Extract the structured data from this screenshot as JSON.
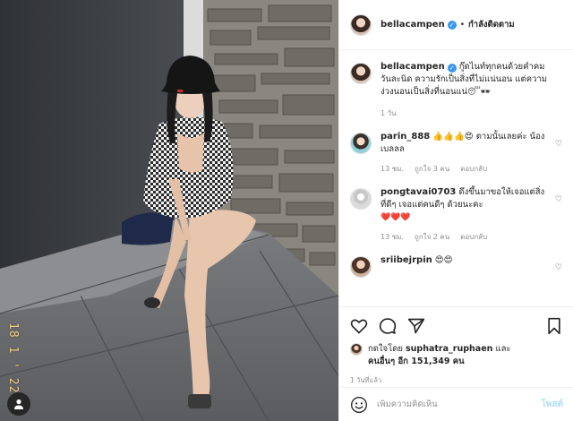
{
  "photo": {
    "date_stamp": "18 1 ' 22",
    "tag_icon": "user-tag-icon"
  },
  "header": {
    "username": "bellacampen",
    "separator": "•",
    "follow_label": "กำลังติดตาม",
    "more_label": "…"
  },
  "caption": {
    "username": "bellacampen",
    "text": "กู๊ดไนท์ทุกคนด้วยคำคม วันละนิด ความรักเป็นสิ่งที่ไม่แน่นอน แต่ความง่วงนอนเป็นสิ่งที่นอนแน่",
    "emoji": "😴🕶",
    "time": "1 วัน"
  },
  "comments": [
    {
      "username": "parin_888",
      "text": "👍👍👍😍 ตามนั้นเลยค่ะ น้องเบลลล",
      "time": "13 ชม.",
      "likes": "ถูกใจ 3 คน",
      "reply": "ตอบกลับ"
    },
    {
      "username": "pongtavai0703",
      "text": "ดึงขึ้นมาขอให้เจอแต่สิ่งที่ดีๆ เจอแต่คนดีๆ ด้วยนะคะ",
      "emoji": "❤️❤️❤️",
      "time": "13 ชม.",
      "likes": "ถูกใจ 2 คน",
      "reply": "ตอบกลับ"
    },
    {
      "username": "sriibejrpin",
      "text": "😍😍"
    }
  ],
  "likes": {
    "prefix": "กดใจโดย",
    "user": "suphatra_ruphaen",
    "middle": "และ",
    "others": "คนอื่นๆ อีก 151,349 คน"
  },
  "post_time": "1 วันที่แล้ว",
  "add_comment": {
    "placeholder": "เพิ่มความคิดเห็น",
    "post_label": "โพสต์"
  },
  "colors": {
    "link_blue": "#3897f0",
    "post_disabled": "#b2dffc",
    "meta_grey": "#8e8e8e"
  }
}
